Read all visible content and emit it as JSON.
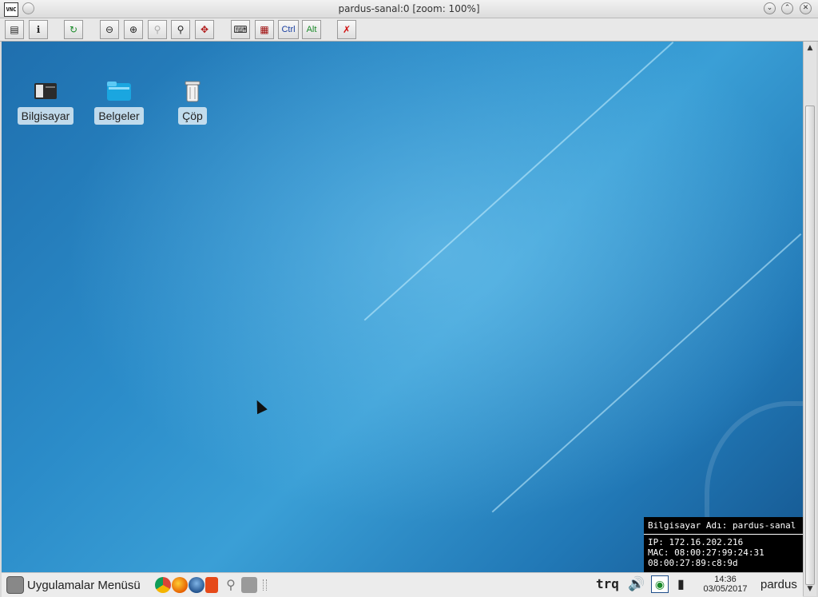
{
  "window": {
    "title": "pardus-sanal:0 [zoom: 100%]",
    "app_icon_text": "VNC"
  },
  "toolbar": {
    "ctrl_label": "Ctrl",
    "alt_label": "Alt",
    "buttons": [
      "options-icon",
      "info-icon",
      "refresh-icon",
      "zoom-out-icon",
      "zoom-in-icon",
      "zoom-100-icon",
      "zoom-fit-icon",
      "fullscreen-icon",
      "send-keys-icon",
      "toggle-toolbar-icon",
      "ctrl-key",
      "alt-key",
      "disconnect-icon"
    ]
  },
  "desktop": {
    "icons": [
      {
        "label": "Bilgisayar",
        "icon": "computer-icon"
      },
      {
        "label": "Belgeler",
        "icon": "documents-folder-icon"
      },
      {
        "label": "Çöp",
        "icon": "trash-icon"
      }
    ]
  },
  "info_panel": {
    "hostname_line": "Bilgisayar Adı: pardus-sanal",
    "ip_line": "IP:  172.16.202.216",
    "mac_line": "MAC: 08:00:27:99:24:31",
    "mac2_line": "08:00:27:89:c8:9d"
  },
  "taskbar": {
    "menu_label": "Uygulamalar Menüsü",
    "keyboard_layout": "trq",
    "clock_time": "14:36",
    "clock_date": "03/05/2017",
    "username": "pardus"
  },
  "colors": {
    "desktop_blue": "#2b8cc9",
    "info_bg": "#000000"
  }
}
